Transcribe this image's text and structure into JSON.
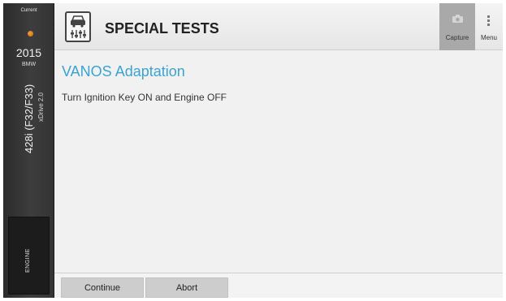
{
  "vehicle": {
    "status_label": "Current",
    "year": "2015",
    "make": "BMW",
    "model": "428i (F32/F33)",
    "engine": "xDrive 2.0",
    "system": "ENGINE"
  },
  "header": {
    "title": "SPECIAL TESTS",
    "app_icon": "car-diagnostic-icon",
    "capture_label": "Capture",
    "capture_icon": "camera-icon",
    "menu_label": "Menu",
    "menu_icon": "kebab-menu-icon"
  },
  "main": {
    "heading": "VANOS Adaptation",
    "message": "Turn Ignition Key ON and Engine OFF"
  },
  "footer": {
    "continue_label": "Continue",
    "abort_label": "Abort"
  },
  "colors": {
    "accent": "#3ba3cf",
    "sidebar": "#333333",
    "status_dot": "#e08a20"
  }
}
